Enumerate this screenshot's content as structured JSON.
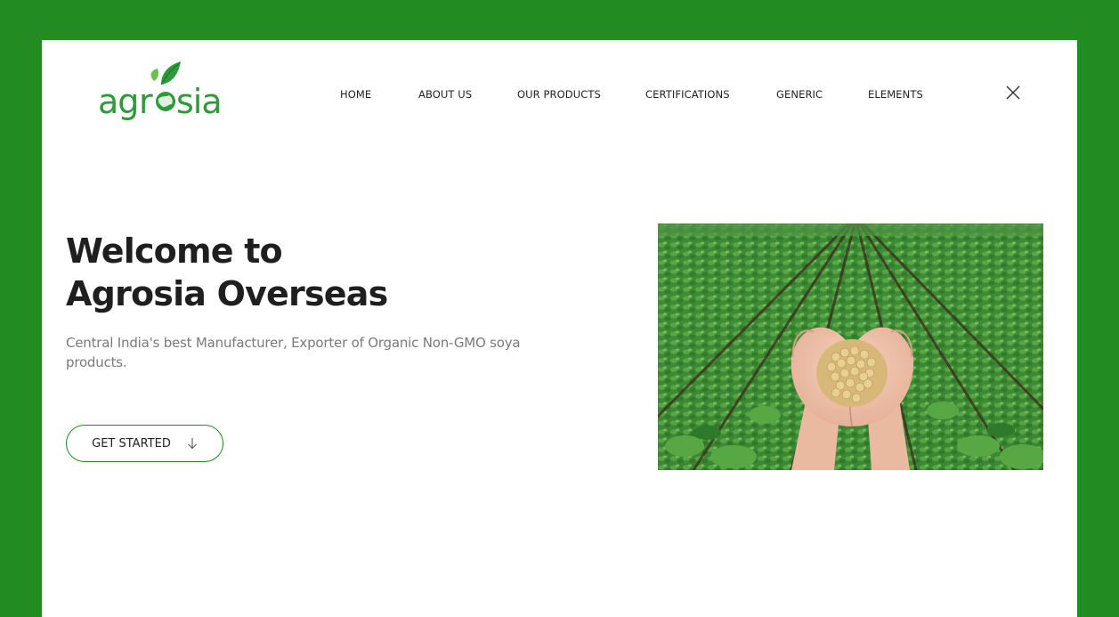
{
  "logo": {
    "text": "agrosia",
    "alt": "agrosia logo"
  },
  "nav": {
    "items": [
      {
        "label": "HOME"
      },
      {
        "label": "ABOUT US"
      },
      {
        "label": "OUR PRODUCTS"
      },
      {
        "label": "CERTIFICATIONS"
      },
      {
        "label": "GENERIC"
      },
      {
        "label": "ELEMENTS"
      }
    ],
    "close_icon": "close-icon"
  },
  "hero": {
    "title_line1": "Welcome to",
    "title_line2": "Agrosia Overseas",
    "subtitle": "Central India's best Manufacturer, Exporter of Organic Non-GMO soya products.",
    "cta_label": "GET STARTED",
    "cta_icon": "arrow-down-icon",
    "image_alt": "Hands holding soybeans over a soybean field"
  },
  "colors": {
    "brand_green": "#228B22",
    "text_dark": "#1f1f1f",
    "text_muted": "#7a7a7a"
  }
}
